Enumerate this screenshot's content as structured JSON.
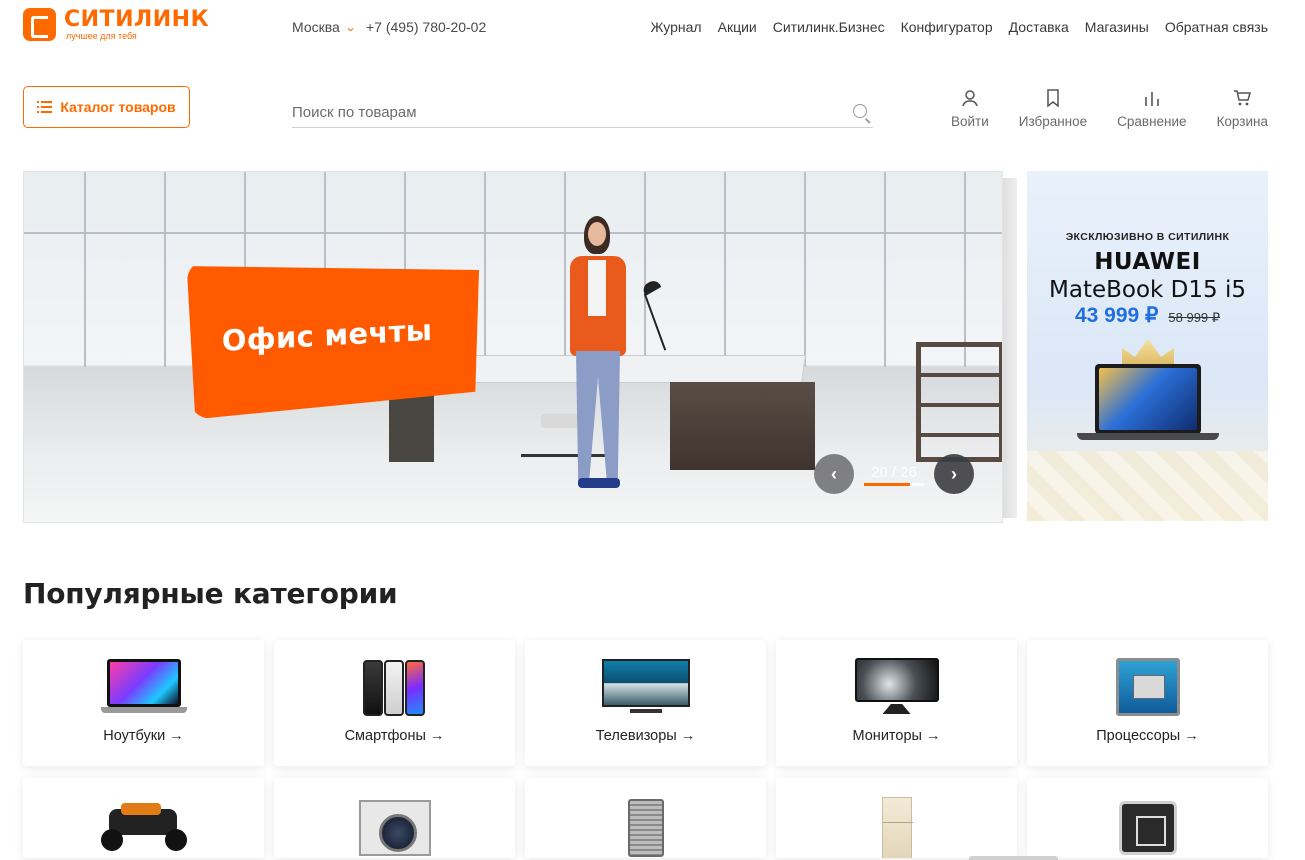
{
  "header": {
    "logo_name": "СИТИЛИНК",
    "logo_tagline": "лучшее для тебя",
    "city": "Москва",
    "phone": "+7 (495) 780-20-02",
    "nav": [
      "Журнал",
      "Акции",
      "Ситилинк.Бизнес",
      "Конфигуратор",
      "Доставка",
      "Магазины",
      "Обратная связь"
    ]
  },
  "toolbar": {
    "catalog_label": "Каталог товаров",
    "search_placeholder": "Поиск по товарам",
    "actions": [
      {
        "label": "Войти",
        "icon": "user-icon"
      },
      {
        "label": "Избранное",
        "icon": "bookmark-icon"
      },
      {
        "label": "Сравнение",
        "icon": "compare-icon"
      },
      {
        "label": "Корзина",
        "icon": "cart-icon"
      }
    ]
  },
  "banner": {
    "title": "Офис мечты",
    "current_slide": 20,
    "total_slides": 26,
    "counter_text": "20 / 26",
    "progress": 0.77
  },
  "side_banner": {
    "exclusive": "ЭКСКЛЮЗИВНО В СИТИЛИНК",
    "brand": "HUAWEI",
    "model": "MateBook D15 i5",
    "price": "43 999 ₽",
    "old_price": "58 999 ₽"
  },
  "categories": {
    "title": "Популярные категории",
    "items": [
      {
        "label": "Ноутбуки →",
        "icon": "laptop-icon"
      },
      {
        "label": "Смартфоны →",
        "icon": "smartphone-icon"
      },
      {
        "label": "Телевизоры →",
        "icon": "tv-icon"
      },
      {
        "label": "Мониторы →",
        "icon": "monitor-icon"
      },
      {
        "label": "Процессоры →",
        "icon": "cpu-icon"
      },
      {
        "label": "",
        "icon": "lawn-mower-icon"
      },
      {
        "label": "",
        "icon": "washing-machine-icon"
      },
      {
        "label": "",
        "icon": "air-purifier-icon"
      },
      {
        "label": "",
        "icon": "fridge-icon"
      },
      {
        "label": "",
        "icon": "control-panel-icon"
      }
    ]
  },
  "colors": {
    "brand": "#ff6a00",
    "price_blue": "#1f6fde"
  }
}
